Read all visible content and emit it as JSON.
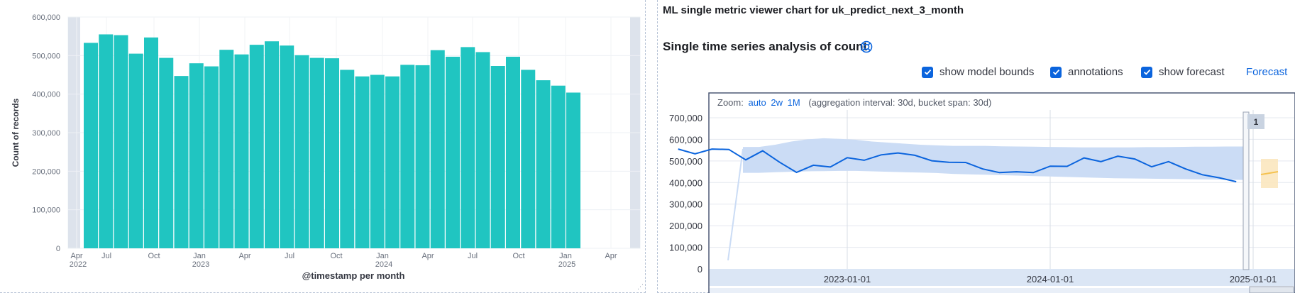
{
  "left_chart": {
    "ylabel": "Count of records",
    "xlabel": "@timestamp per month",
    "y_ticks": [
      "600,000",
      "500,000",
      "400,000",
      "300,000",
      "200,000",
      "100,000",
      "0"
    ],
    "x_ticks": [
      {
        "label": "Apr",
        "sub": "2022"
      },
      {
        "label": "Jul",
        "sub": ""
      },
      {
        "label": "Oct",
        "sub": ""
      },
      {
        "label": "Jan",
        "sub": "2023"
      },
      {
        "label": "Apr",
        "sub": ""
      },
      {
        "label": "Jul",
        "sub": ""
      },
      {
        "label": "Oct",
        "sub": ""
      },
      {
        "label": "Jan",
        "sub": "2024"
      },
      {
        "label": "Apr",
        "sub": ""
      },
      {
        "label": "Jul",
        "sub": ""
      },
      {
        "label": "Oct",
        "sub": ""
      },
      {
        "label": "Jan",
        "sub": "2025"
      },
      {
        "label": "Apr",
        "sub": ""
      }
    ]
  },
  "right_panel": {
    "title": "ML single metric viewer chart for uk_predict_next_3_month",
    "subtitle": "Single time series analysis of count",
    "options": {
      "model_bounds": "show model bounds",
      "annotations": "annotations",
      "forecast": "show forecast"
    },
    "forecast_link": "Forecast",
    "zoom": {
      "label": "Zoom:",
      "auto": "auto",
      "two_weeks": "2w",
      "one_month": "1M",
      "info": "(aggregation interval: 30d, bucket span: 30d)"
    },
    "y_ticks": [
      "700,000",
      "600,000",
      "500,000",
      "400,000",
      "300,000",
      "200,000",
      "100,000",
      "0"
    ],
    "x_ticks": [
      "2023-01-01",
      "2024-01-01",
      "2025-01-01"
    ],
    "annotation_badge": "1"
  },
  "chart_data": [
    {
      "type": "bar",
      "xlabel": "@timestamp per month",
      "ylabel": "Count of records",
      "ylim": [
        0,
        600000
      ],
      "grid": true,
      "color": "#20c5c1",
      "categories": [
        "2022-04",
        "2022-05",
        "2022-06",
        "2022-07",
        "2022-08",
        "2022-09",
        "2022-10",
        "2022-11",
        "2022-12",
        "2023-01",
        "2023-02",
        "2023-03",
        "2023-04",
        "2023-05",
        "2023-06",
        "2023-07",
        "2023-08",
        "2023-09",
        "2023-10",
        "2023-11",
        "2023-12",
        "2024-01",
        "2024-02",
        "2024-03",
        "2024-04",
        "2024-05",
        "2024-06",
        "2024-07",
        "2024-08",
        "2024-09",
        "2024-10",
        "2024-11",
        "2024-12",
        "2025-01"
      ],
      "values": [
        533000,
        555000,
        553000,
        505000,
        547000,
        494000,
        447000,
        480000,
        472000,
        515000,
        503000,
        528000,
        537000,
        526000,
        501000,
        494000,
        493000,
        463000,
        446000,
        450000,
        446000,
        476000,
        475000,
        514000,
        497000,
        522000,
        509000,
        473000,
        497000,
        463000,
        436000,
        422000,
        404000
      ]
    },
    {
      "type": "line",
      "title": "Single time series analysis of count",
      "ylim": [
        0,
        700000
      ],
      "grid": true,
      "series": [
        {
          "x": [
            "2022-03",
            "2022-04",
            "2022-05",
            "2022-06",
            "2022-07",
            "2022-08",
            "2022-09",
            "2022-10",
            "2022-11",
            "2022-12",
            "2023-01",
            "2023-02",
            "2023-03",
            "2023-04",
            "2023-05",
            "2023-06",
            "2023-07",
            "2023-08",
            "2023-09",
            "2023-10",
            "2023-11",
            "2023-12",
            "2024-01",
            "2024-02",
            "2024-03",
            "2024-04",
            "2024-05",
            "2024-06",
            "2024-07",
            "2024-08",
            "2024-09",
            "2024-10",
            "2024-11",
            "2024-12"
          ],
          "values": [
            555000,
            533000,
            555000,
            553000,
            505000,
            547000,
            494000,
            447000,
            480000,
            472000,
            515000,
            503000,
            528000,
            537000,
            526000,
            501000,
            494000,
            493000,
            463000,
            446000,
            450000,
            446000,
            476000,
            475000,
            514000,
            497000,
            522000,
            509000,
            473000,
            497000,
            463000,
            436000,
            422000,
            404000
          ],
          "color": "#0b64dd"
        }
      ],
      "model_bounds_color": "#cbdcf5",
      "forecast_color": "#f5c24f"
    }
  ]
}
